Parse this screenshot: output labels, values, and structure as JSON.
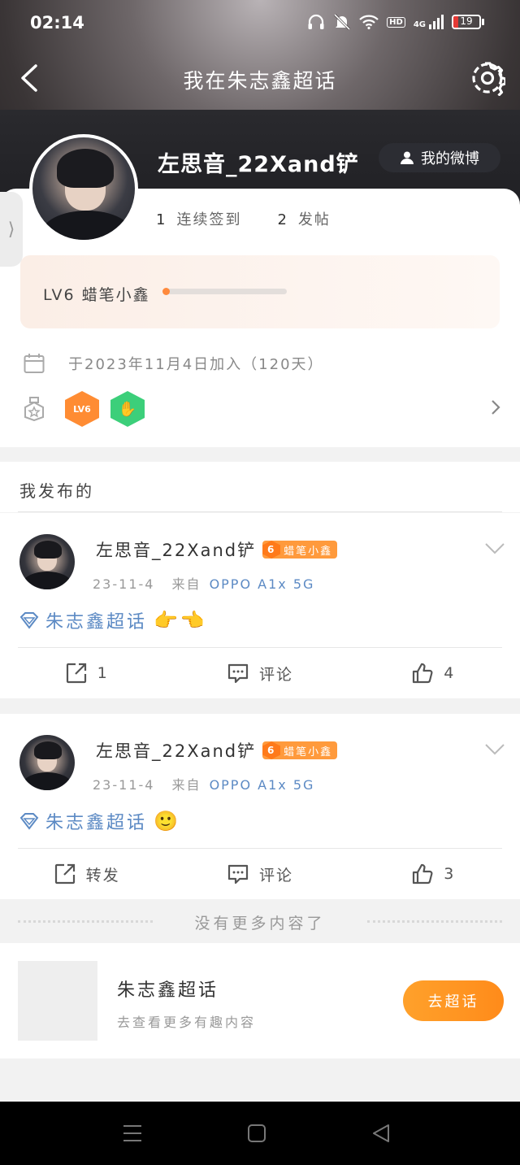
{
  "status_bar": {
    "time": "02:14",
    "hd": "HD",
    "signal": "4G",
    "battery": "19"
  },
  "nav": {
    "title": "我在朱志鑫超话"
  },
  "profile": {
    "username": "左思音_22Xand铲",
    "weibo_button": "我的微博",
    "signin_count": "1",
    "signin_label": "连续签到",
    "posts_count": "2",
    "posts_label": "发帖",
    "level_text": "LV6 蜡笔小鑫",
    "level_progress": 0.05,
    "join_text": "于2023年11月4日加入（120天）",
    "badge_lv6": "LV6"
  },
  "section": {
    "title": "我发布的"
  },
  "posts": [
    {
      "author": "左思音_22Xand铲",
      "level_num": "6",
      "level_name": "蜡笔小鑫",
      "date": "23-11-4",
      "from": "来自",
      "device": "OPPO A1x 5G",
      "topic": "朱志鑫超话",
      "emoji": "👉👈",
      "repost": "1",
      "comment": "评论",
      "likes": "4"
    },
    {
      "author": "左思音_22Xand铲",
      "level_num": "6",
      "level_name": "蜡笔小鑫",
      "date": "23-11-4",
      "from": "来自",
      "device": "OPPO A1x 5G",
      "topic": "朱志鑫超话",
      "emoji": "🙂",
      "repost": "转发",
      "comment": "评论",
      "likes": "3"
    }
  ],
  "end_text": "没有更多内容了",
  "footer": {
    "title": "朱志鑫超话",
    "subtitle": "去查看更多有趣内容",
    "button": "去超话"
  },
  "colors": {
    "accent": "#ff8b1a",
    "link": "#5c8ac4"
  }
}
